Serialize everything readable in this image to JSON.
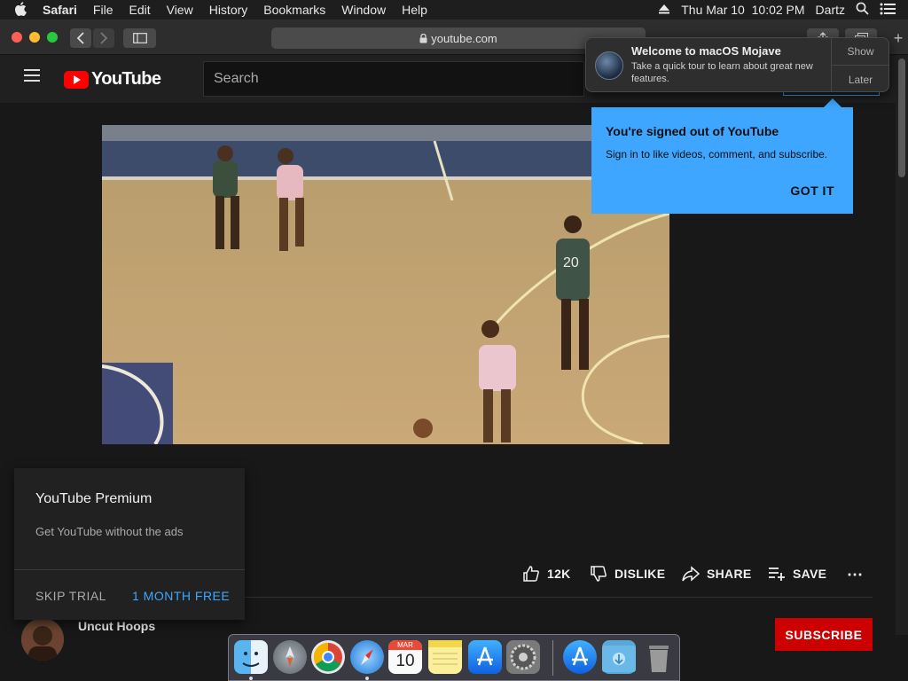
{
  "menubar": {
    "apple": "",
    "app_name": "Safari",
    "items": [
      "File",
      "Edit",
      "View",
      "History",
      "Bookmarks",
      "Window",
      "Help"
    ],
    "clock": "Thu Mar 10  10:02 PM",
    "user": "Dartz"
  },
  "browser": {
    "url": "youtube.com"
  },
  "youtube": {
    "logo_text": "YouTube",
    "search_placeholder": "Search"
  },
  "actions": {
    "likes": "12K",
    "dislike": "DISLIKE",
    "share": "SHARE",
    "save": "SAVE",
    "more": "⋯"
  },
  "channel": {
    "name": "Uncut Hoops",
    "subscribe_label": "SUBSCRIBE"
  },
  "premium_popup": {
    "title": "YouTube Premium",
    "description": "Get YouTube without the ads",
    "skip_label": "SKIP TRIAL",
    "free_label": "1 MONTH FREE"
  },
  "signed_out_tooltip": {
    "title": "You're signed out of YouTube",
    "description": "Sign in to like videos, comment, and subscribe.",
    "button": "GOT IT"
  },
  "notification": {
    "title": "Welcome to macOS Mojave",
    "description": "Take a quick tour to learn about great new features.",
    "show_label": "Show",
    "later_label": "Later"
  },
  "calendar_icon": {
    "month": "MAR",
    "day": "10"
  },
  "colors": {
    "youtube_red": "#ff0000",
    "link_blue": "#3ea6ff",
    "subscribe_red": "#cc0000",
    "page_bg": "#181818"
  }
}
